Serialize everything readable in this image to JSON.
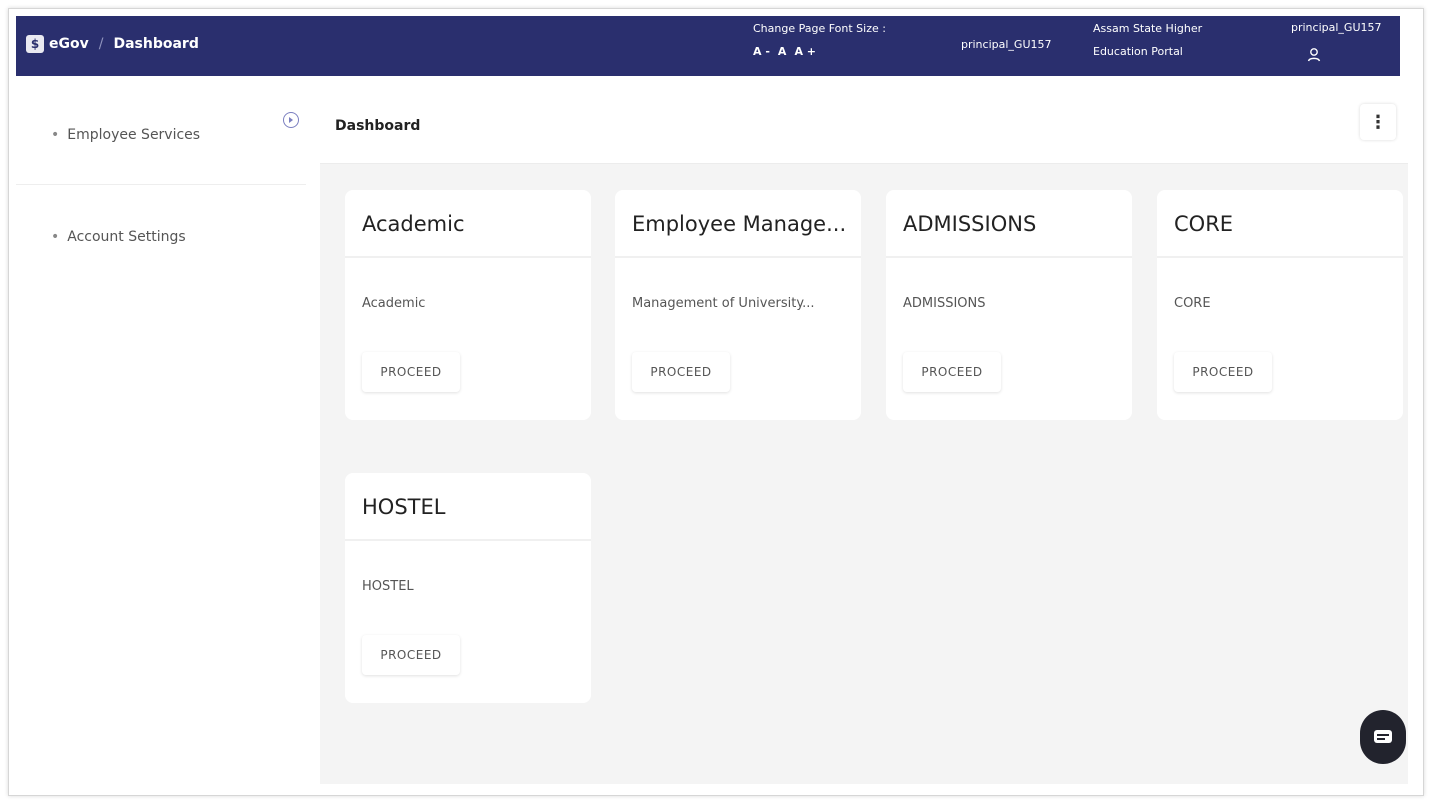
{
  "header": {
    "brand": "eGov",
    "brand_logo": "$",
    "separator": "/",
    "page": "Dashboard",
    "font_size_label": "Change Page Font Size :",
    "font_decrease": "A -",
    "font_normal": "A",
    "font_increase": "A +",
    "user_primary": "principal_GU157",
    "portal_line1": "Assam State Higher",
    "portal_line2": "Education Portal",
    "user_secondary": "principal_GU157",
    "bg_color": "#2a2f6e"
  },
  "sidebar": {
    "items": [
      {
        "label": "Employee Services"
      },
      {
        "label": "Account Settings"
      }
    ]
  },
  "main": {
    "title": "Dashboard",
    "menu_glyph": "⋮",
    "cards": [
      {
        "title": "Academic",
        "desc": "Academic",
        "button": "PROCEED"
      },
      {
        "title": "Employee Manage...",
        "desc": "Management of University...",
        "button": "PROCEED"
      },
      {
        "title": "ADMISSIONS",
        "desc": "ADMISSIONS",
        "button": "PROCEED"
      },
      {
        "title": "CORE",
        "desc": "CORE",
        "button": "PROCEED"
      },
      {
        "title": "HOSTEL",
        "desc": "HOSTEL",
        "button": "PROCEED"
      }
    ]
  }
}
